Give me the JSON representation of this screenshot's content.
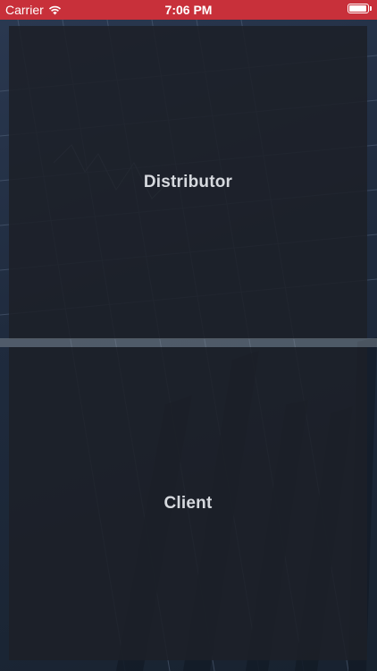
{
  "status_bar": {
    "carrier": "Carrier",
    "time": "7:06 PM",
    "background_color": "#c8303a"
  },
  "menu": {
    "distributor_label": "Distributor",
    "client_label": "Client"
  },
  "background": {
    "description_icon": "financial-chart-background",
    "tint_color": "#1c2028"
  }
}
